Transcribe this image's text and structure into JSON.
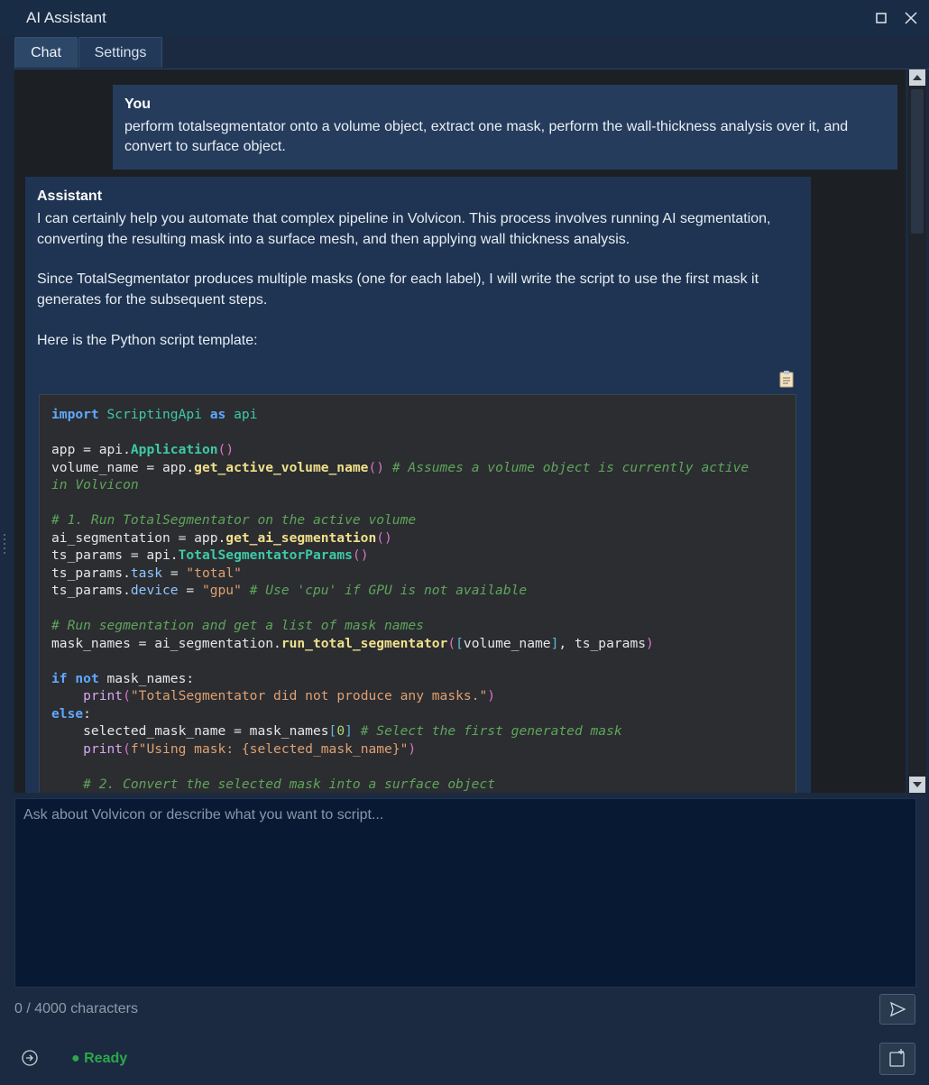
{
  "window": {
    "title": "AI Assistant"
  },
  "tabs": [
    {
      "label": "Chat"
    },
    {
      "label": "Settings"
    }
  ],
  "messages": {
    "user": {
      "sender": "You",
      "text": "perform totalsegmentator onto a volume object, extract one mask, perform the wall-thickness analysis over it, and convert to surface object."
    },
    "assistant": {
      "sender": "Assistant",
      "paragraphs": [
        "I can certainly help you automate that complex pipeline in Volvicon. This process involves running AI segmentation, converting the resulting mask into a surface mesh, and then applying wall thickness analysis.",
        "Since TotalSegmentator produces multiple masks (one for each label), I will write the script to use the first mask it generates for the subsequent steps.",
        "Here is the Python script template:"
      ],
      "code_language": "python",
      "code": [
        "import ScriptingApi as api",
        "",
        "app = api.Application()",
        "volume_name = app.get_active_volume_name() # Assumes a volume object is currently active",
        "in Volvicon",
        "",
        "# 1. Run TotalSegmentator on the active volume",
        "ai_segmentation = app.get_ai_segmentation()",
        "ts_params = api.TotalSegmentatorParams()",
        "ts_params.task = \"total\"",
        "ts_params.device = \"gpu\" # Use 'cpu' if GPU is not available",
        "",
        "# Run segmentation and get a list of mask names",
        "mask_names = ai_segmentation.run_total_segmentator([volume_name], ts_params)",
        "",
        "if not mask_names:",
        "    print(\"TotalSegmentator did not produce any masks.\")",
        "else:",
        "    selected_mask_name = mask_names[0] # Select the first generated mask",
        "    print(f\"Using mask: {selected_mask_name}\")",
        "",
        "    # 2. Convert the selected mask into a surface object"
      ]
    }
  },
  "input": {
    "placeholder": "Ask about Volvicon or describe what you want to script...",
    "value": ""
  },
  "char_count": "0 / 4000 characters",
  "status": {
    "text": "● Ready",
    "color": "#2aa84a"
  },
  "icons": {
    "maximize": "maximize-icon",
    "close": "close-icon",
    "copy": "clipboard-icon",
    "send": "send-icon",
    "status": "circle-arrow-icon",
    "new_chat": "new-chat-icon"
  },
  "colors": {
    "accent_bg": "#1b2a40",
    "user_bubble": "#253c5c",
    "assistant_bubble": "#1f3452",
    "code_bg": "#2b2d31"
  }
}
